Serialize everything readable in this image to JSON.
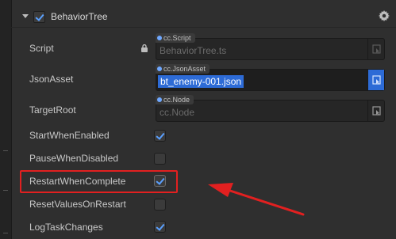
{
  "component": {
    "title": "BehaviorTree",
    "enabled": true,
    "icons": [
      "caret-down-icon",
      "gear-icon"
    ]
  },
  "properties": {
    "script": {
      "label": "Script",
      "type_tag": "cc.Script",
      "value": "BehaviorTree.ts"
    },
    "json_asset": {
      "label": "JsonAsset",
      "type_tag": "cc.JsonAsset",
      "value": "bt_enemy-001.json"
    },
    "target_root": {
      "label": "TargetRoot",
      "type_tag": "cc.Node",
      "placeholder": "cc.Node"
    },
    "start_when_enabled": {
      "label": "StartWhenEnabled",
      "checked": true
    },
    "pause_when_disabled": {
      "label": "PauseWhenDisabled",
      "checked": false
    },
    "restart_when_complete": {
      "label": "RestartWhenComplete",
      "checked": true
    },
    "reset_values_on_restart": {
      "label": "ResetValuesOnRestart",
      "checked": false
    },
    "log_task_changes": {
      "label": "LogTaskChanges",
      "checked": true
    }
  },
  "colors": {
    "accent": "#2d6bd6",
    "highlight": "#e22020",
    "check": "#5aa0ff"
  }
}
